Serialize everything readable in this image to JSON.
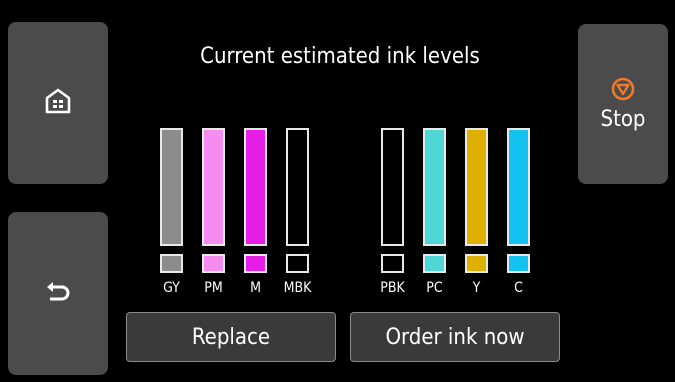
{
  "title": "Current estimated ink levels",
  "buttons": {
    "home_icon": "home-icon",
    "back_icon": "back-arrow-icon",
    "stop_label": "Stop",
    "stop_icon": "stop-icon",
    "replace_label": "Replace",
    "order_label": "Order ink now"
  },
  "tanks": [
    {
      "name": "GY",
      "color": "#8c8c8c",
      "level": 1.0
    },
    {
      "name": "PM",
      "color": "#f58cf0",
      "level": 1.0
    },
    {
      "name": "M",
      "color": "#e61ee6",
      "level": 1.0
    },
    {
      "name": "MBK",
      "color": "#000000",
      "level": 0.0
    },
    {
      "name": "PBK",
      "color": "#000000",
      "level": 0.0
    },
    {
      "name": "PC",
      "color": "#4fd6d6",
      "level": 1.0
    },
    {
      "name": "Y",
      "color": "#e0b000",
      "level": 1.0
    },
    {
      "name": "C",
      "color": "#13c2f0",
      "level": 1.0
    }
  ],
  "colors": {
    "screen_bg": "#000000",
    "button_bg": "#4b4b4b",
    "stop_accent": "#f0782a"
  }
}
